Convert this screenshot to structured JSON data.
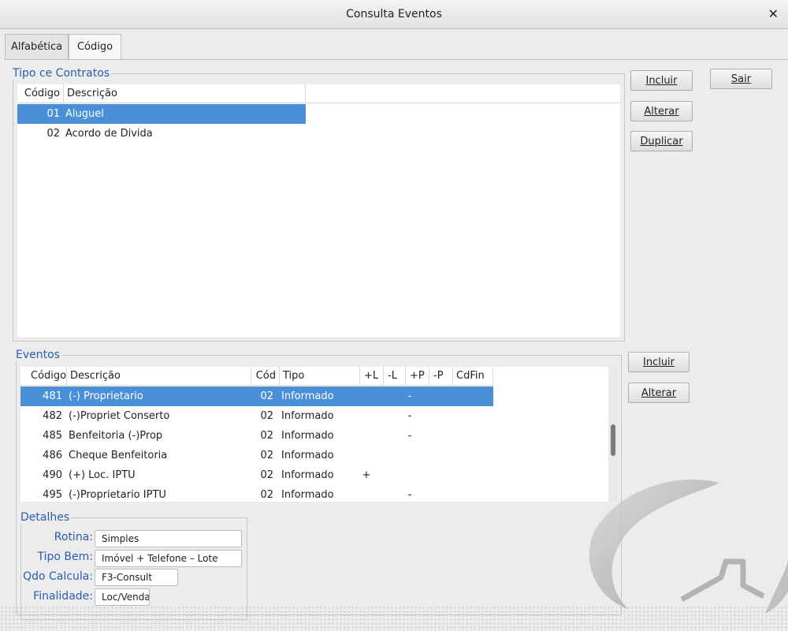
{
  "window": {
    "title": "Consulta Eventos"
  },
  "tabs": [
    {
      "label": "Alfabética"
    },
    {
      "label": "Código"
    }
  ],
  "contracts": {
    "legend": "Tipo ce Contratos",
    "columns": [
      "Código",
      "Descrição"
    ],
    "rows": [
      {
        "code": "01",
        "desc": "Aluguel"
      },
      {
        "code": "02",
        "desc": "Acordo de Divida"
      }
    ],
    "buttons": {
      "include": "Incluir",
      "alter": "Alterar",
      "duplicate": "Duplicar"
    }
  },
  "exit_button": "Sair",
  "events": {
    "legend": "Eventos",
    "columns": [
      "Código",
      "Descrição",
      "Cód",
      "Tipo",
      "+L",
      "-L",
      "+P",
      "-P",
      "CdFin"
    ],
    "rows": [
      {
        "code": "481",
        "desc": "(-) Proprietario",
        "cod": "02",
        "tipo": "Informado",
        "pl": "",
        "ml": "",
        "pp": "-",
        "mp": "",
        "cdfin": ""
      },
      {
        "code": "482",
        "desc": "(-)Propriet Conserto",
        "cod": "02",
        "tipo": "Informado",
        "pl": "",
        "ml": "",
        "pp": "-",
        "mp": "",
        "cdfin": ""
      },
      {
        "code": "485",
        "desc": "Benfeitoria (-)Prop",
        "cod": "02",
        "tipo": "Informado",
        "pl": "",
        "ml": "",
        "pp": "-",
        "mp": "",
        "cdfin": ""
      },
      {
        "code": "486",
        "desc": "Cheque Benfeitoria",
        "cod": "02",
        "tipo": "Informado",
        "pl": "",
        "ml": "",
        "pp": "",
        "mp": "",
        "cdfin": ""
      },
      {
        "code": "490",
        "desc": "(+) Loc. IPTU",
        "cod": "02",
        "tipo": "Informado",
        "pl": "+",
        "ml": "",
        "pp": "",
        "mp": "",
        "cdfin": ""
      },
      {
        "code": "495",
        "desc": "(-)Proprietario IPTU",
        "cod": "02",
        "tipo": "Informado",
        "pl": "",
        "ml": "",
        "pp": "-",
        "mp": "",
        "cdfin": ""
      }
    ],
    "buttons": {
      "include": "Incluir",
      "alter": "Alterar"
    }
  },
  "details": {
    "legend": "Detalhes",
    "rotina_label": "Rotina:",
    "rotina_value": "Simples",
    "tipobem_label": "Tipo Bem:",
    "tipobem_value": "Imóvel + Telefone – Lote",
    "qdo_label": "Qdo Calcula:",
    "qdo_value": "F3-Consult",
    "finalidade_label": "Finalidade:",
    "finalidade_value": "Loc/Venda"
  },
  "colors": {
    "selection": "#4a90d9",
    "legend": "#2a5db0"
  },
  "icons": {
    "close": "close-icon",
    "logo": "crescent-logo"
  }
}
